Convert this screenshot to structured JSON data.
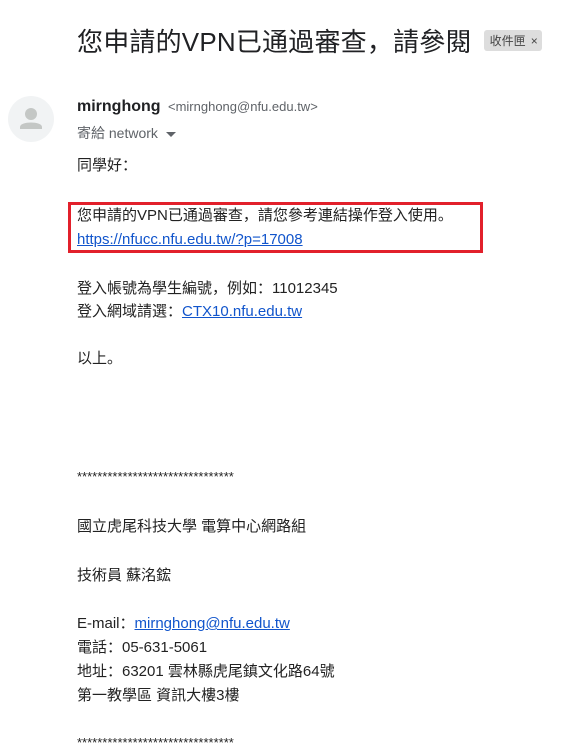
{
  "subject": "您申請的VPN已通過審查，請參閱",
  "label": {
    "text": "收件匣",
    "close": "×"
  },
  "sender": {
    "name": "mirnghong",
    "email": "<mirnghong@nfu.edu.tw>"
  },
  "recipient": "寄給 network",
  "body": {
    "greeting": "同學好：",
    "notice": "您申請的VPN已通過審查，請您參考連結操作登入使用。",
    "notice_link": "https://nfucc.nfu.edu.tw/?p=17008",
    "account_line": "登入帳號為學生編號，例如：11012345",
    "domain_prefix": "登入網域請選：",
    "domain_link": "CTX10.nfu.edu.tw",
    "closing": "以上。",
    "separator": "*******************************",
    "org": "國立虎尾科技大學 電算中心網路組",
    "staff": "技術員 蘇洺鋐",
    "email_prefix": "E-mail：",
    "email_link": "mirnghong@nfu.edu.tw",
    "phone": "電話：05-631-5061",
    "address": "地址：63201 雲林縣虎尾鎮文化路64號",
    "building": "第一教學區 資訊大樓3樓",
    "separator_end": "*******************************"
  },
  "colors": {
    "highlight_border": "#e2202b",
    "link": "#1155cc"
  }
}
